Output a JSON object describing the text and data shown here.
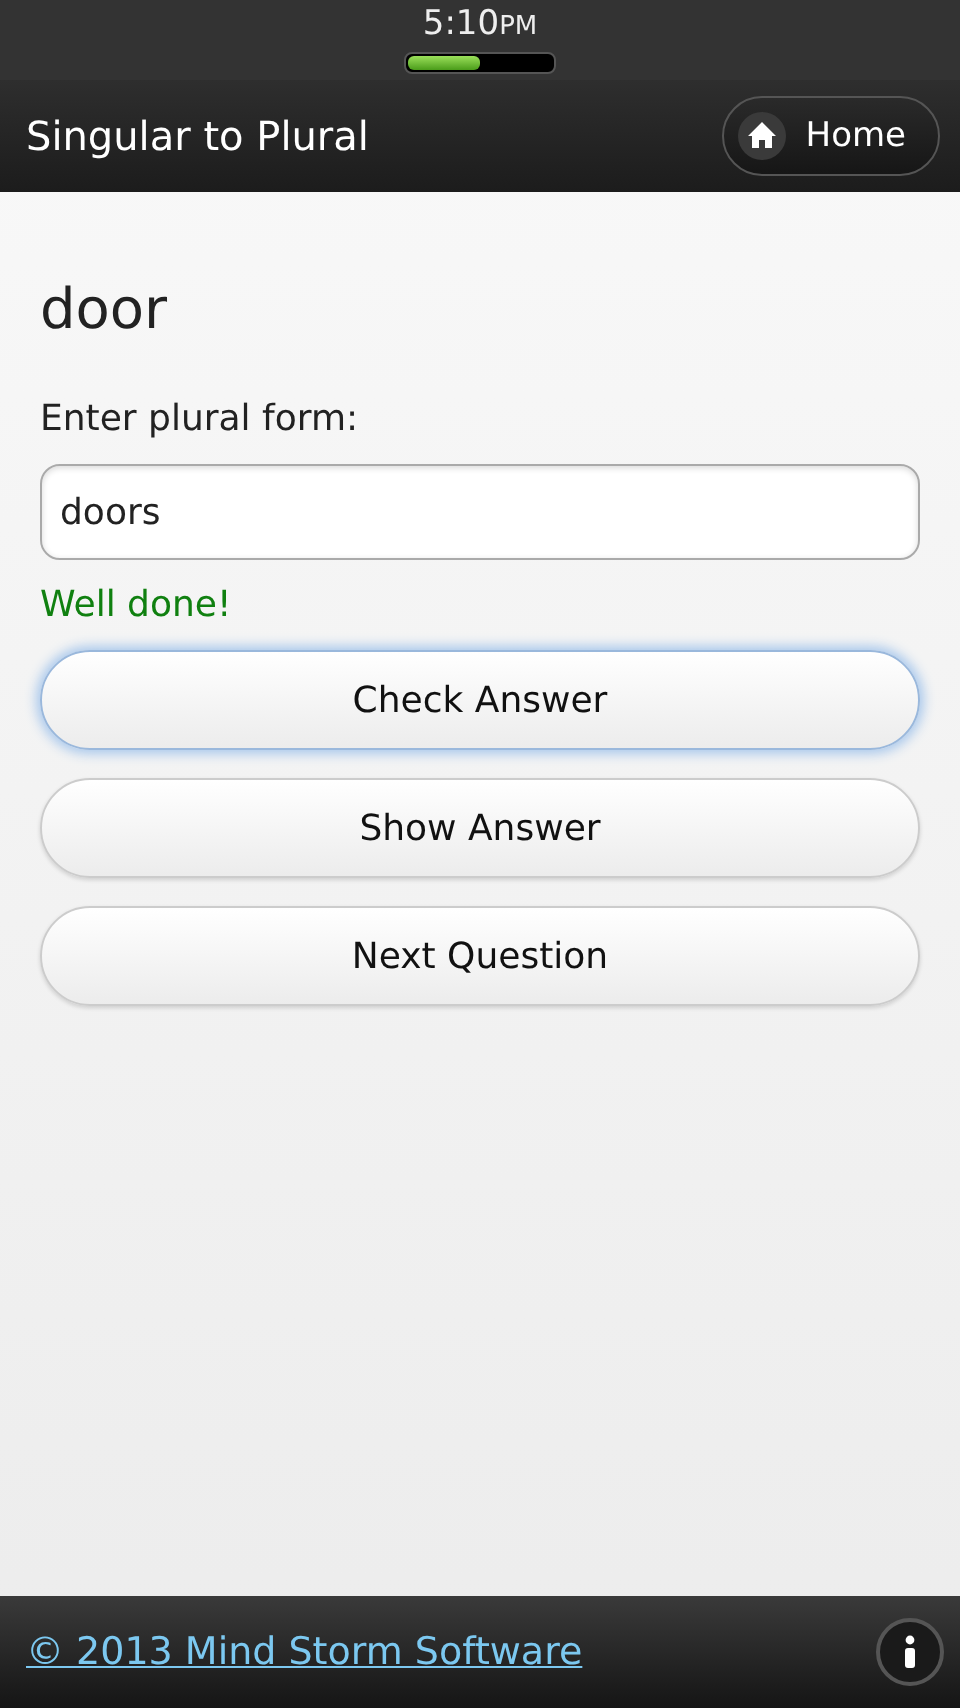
{
  "status_bar": {
    "time": "5:10",
    "period": "PM"
  },
  "header": {
    "title": "Singular to Plural",
    "home_button": "Home"
  },
  "word": "door",
  "prompt": "Enter plural form:",
  "answer_field": {
    "value": "doors"
  },
  "feedback": "Well done!",
  "buttons": [
    {
      "label": "Check Answer",
      "focused": true
    },
    {
      "label": "Show Answer",
      "focused": false
    },
    {
      "label": "Next Question",
      "focused": false
    }
  ],
  "footer": {
    "link": "© 2013 Mind Storm Software"
  }
}
